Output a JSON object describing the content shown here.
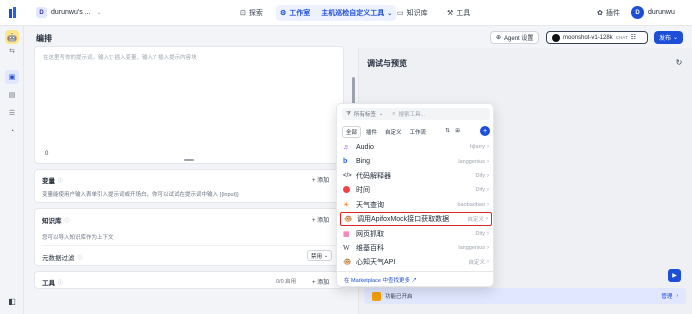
{
  "topbar": {
    "workspace_initial": "D",
    "workspace_name": "durunwu's ...",
    "nav": [
      {
        "label": "探索"
      },
      {
        "label": "工作室"
      },
      {
        "label": "主机巡检自定义工具"
      },
      {
        "label": "知识库"
      },
      {
        "label": "工具"
      }
    ],
    "plugin_label": "插件",
    "user_initial": "D",
    "user_name": "durunwu"
  },
  "editor": {
    "section_title": "编排",
    "agent_settings_label": "Agent 设置",
    "model_name": "moonshot-v1-128k",
    "model_badge": "CHAT",
    "publish_label": "发布",
    "prompt_placeholder": "在这里写你的提示词，输入'{' 插入变量、输入'/' 插入提示内容块",
    "char_count": "0",
    "variables": {
      "title": "变量",
      "add": "+ 添加",
      "desc": "变量能使用户输入表单引入提示词或开场白，你可以试试在提示词中输入 {{input}}"
    },
    "context": {
      "title": "知识库",
      "add": "+ 添加",
      "desc": "您可以导入知识库作为上下文"
    },
    "metadata": {
      "title": "元数据过滤",
      "value": "禁用"
    },
    "tools": {
      "title": "工具",
      "count": "0/0 启用",
      "add": "+ 添加"
    }
  },
  "debug": {
    "title": "调试与预览",
    "opener_label": "功能已开启",
    "manage_label": "管理"
  },
  "tool_popup": {
    "filter_label": "所有标签",
    "search_placeholder": "搜索工具...",
    "tabs": [
      "全部",
      "插件",
      "自定义",
      "工作流"
    ],
    "items": [
      {
        "name": "Audio",
        "author": "hjlarry",
        "icon": "audio-icon",
        "color": "#a855f7"
      },
      {
        "name": "Bing",
        "author": "langgenius",
        "icon": "bing-icon",
        "color": "#2563eb"
      },
      {
        "name": "代码解释器",
        "author": "Dify",
        "icon": "code-icon",
        "color": "#111827"
      },
      {
        "name": "时间",
        "author": "Dify",
        "icon": "clock-icon",
        "color": "#ef4444"
      },
      {
        "name": "天气查询",
        "author": "baobaobao",
        "icon": "weather-icon",
        "color": "#f97316"
      },
      {
        "name": "调用ApifoxMock接口获取数据",
        "author": "自定义",
        "icon": "custom-tool-icon",
        "color": "#f59e0b"
      },
      {
        "name": "网页抓取",
        "author": "Dify",
        "icon": "web-scraper-icon",
        "color": "#ec4899"
      },
      {
        "name": "维基百科",
        "author": "langgenius",
        "icon": "wikipedia-icon",
        "color": "#374151"
      },
      {
        "name": "心知天气API",
        "author": "自定义",
        "icon": "weather-api-icon",
        "color": "#f59e0b"
      }
    ],
    "marketplace_link": "在 Marketplace 中查找更多 ↗"
  }
}
